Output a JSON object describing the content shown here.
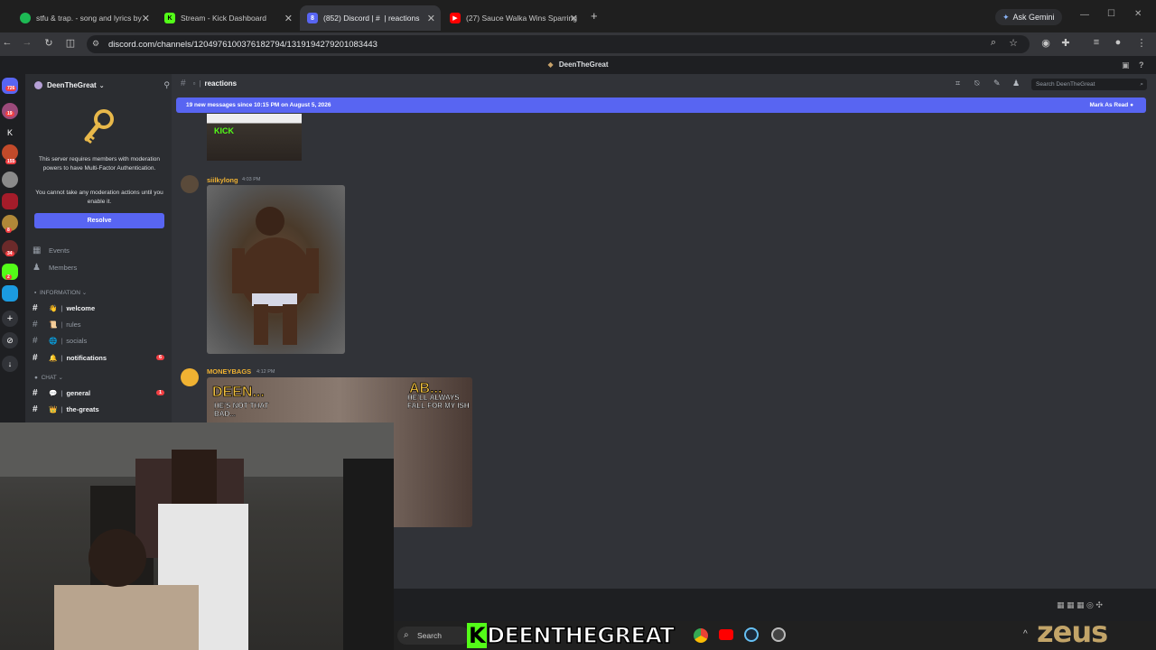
{
  "browser": {
    "tabs": [
      {
        "title": "stfu & trap. - song and lyrics by",
        "icon": "spotify-icon",
        "color": "#1db954"
      },
      {
        "title": "Stream - Kick Dashboard",
        "icon": "kick-icon",
        "color": "#53fc18"
      },
      {
        "title": "(852) Discord | # ⁠ | reactions",
        "icon": "discord-icon",
        "color": "#5865f2"
      },
      {
        "title": "(27) Sauce Walka Wins Sparring",
        "icon": "youtube-icon",
        "color": "#ff0000"
      }
    ],
    "ask_gemini": "Ask Gemini",
    "url": "discord.com/channels/1204976100376182794/1319194279201083443",
    "window_title": "DeenTheGreat"
  },
  "discord": {
    "server_name": "DeenTheGreat",
    "mfa_notice": "This server requires members with moderation powers to have Multi-Factor Authentication.",
    "mfa_notice2": "You cannot take any moderation actions until you enable it.",
    "resolve_label": "Resolve",
    "events_label": "Events",
    "members_label": "Members",
    "categories": {
      "information": "INFORMATION",
      "chat": "CHAT"
    },
    "info_channels": [
      {
        "name": "welcome",
        "emoji": "👋",
        "bold": true
      },
      {
        "name": "rules",
        "emoji": "📜",
        "bold": false
      },
      {
        "name": "socials",
        "emoji": "🌐",
        "bold": false
      },
      {
        "name": "notifications",
        "emoji": "🔔",
        "bold": true,
        "badge": "6"
      }
    ],
    "chat_channels": [
      {
        "name": "general",
        "emoji": "💬",
        "bold": true,
        "badge": "1"
      },
      {
        "name": "the-greats",
        "emoji": "👑",
        "bold": true
      }
    ],
    "guild_badges": [
      "726",
      "19",
      "155",
      "8",
      "34",
      "2"
    ],
    "channel_header": "reactions",
    "search_placeholder": "Search DeenTheGreat",
    "banner_text": "19 new messages since 10:15 PM on August 5, 2026",
    "mark_as_read": "Mark As Read",
    "messages": [
      {
        "author": "siilkylong",
        "time": "4:03 PM",
        "color": "#f0b232"
      },
      {
        "author": "MONEYBAGS",
        "time": "4:12 PM",
        "color": "#f0b232"
      }
    ],
    "thumb_text": {
      "left_top": "DEEN...",
      "left_sub": "HE'S NOT THAT BAD...",
      "right_top": "AB...",
      "right_sub": "HE'LL ALWAYS FALL FOR MY ISH"
    },
    "kick_text": "KICK"
  },
  "taskbar": {
    "search": "Search"
  },
  "overlay": {
    "streamer_name": "DEENTHEGREAT",
    "brand": "zeus"
  }
}
